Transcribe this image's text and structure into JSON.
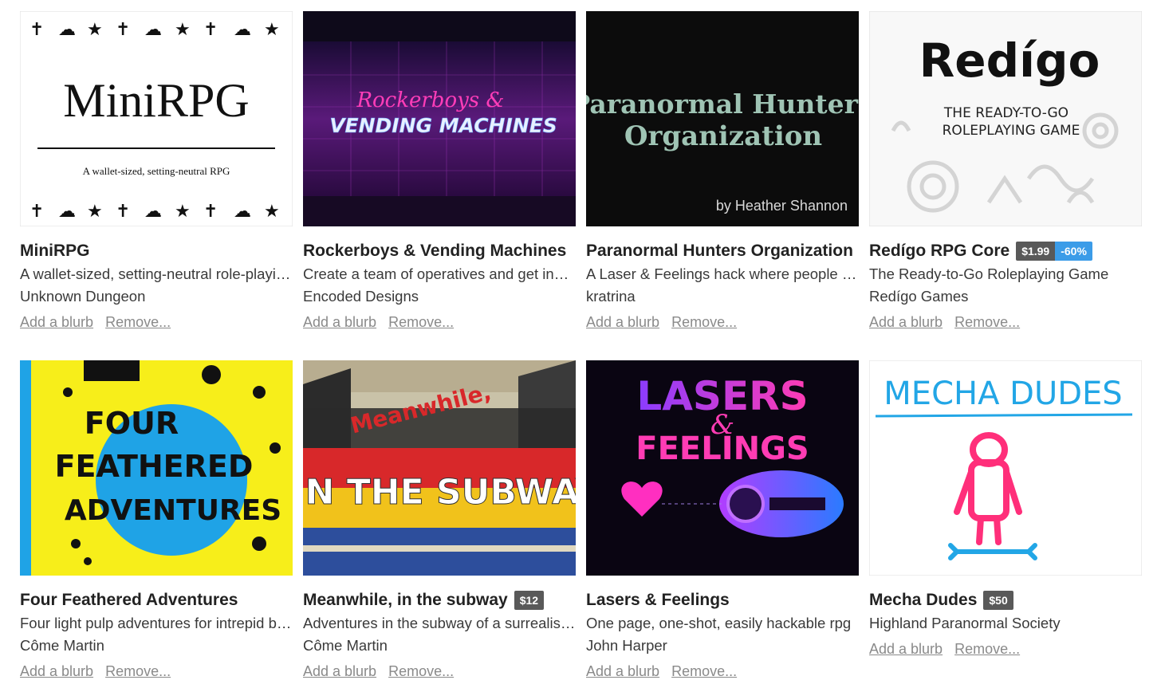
{
  "items": [
    {
      "title": "MiniRPG",
      "description": "A wallet-sized, setting-neutral role-playi…",
      "author": "Unknown Dungeon",
      "price": "",
      "discount": "",
      "cover_text": [
        "MiniRPG",
        "A wallet-sized, setting-neutral RPG"
      ],
      "add_blurb": "Add a blurb",
      "remove": "Remove..."
    },
    {
      "title": "Rockerboys & Vending Machines",
      "description": "Create a team of operatives and get invol…",
      "author": "Encoded Designs",
      "price": "",
      "discount": "",
      "cover_text": [
        "Rockerboys &",
        "VENDING MACHINES"
      ],
      "add_blurb": "Add a blurb",
      "remove": "Remove..."
    },
    {
      "title": "Paranormal Hunters Organization",
      "description": "A Laser & Feelings hack where people ta…",
      "author": "kratrina",
      "price": "",
      "discount": "",
      "cover_text": [
        "Paranormal Hunters",
        "Organization",
        "by Heather Shannon"
      ],
      "add_blurb": "Add a blurb",
      "remove": "Remove..."
    },
    {
      "title": "Redígo RPG Core",
      "description": "The Ready-to-Go Roleplaying Game",
      "author": "Redígo Games",
      "price": "$1.99",
      "discount": "-60%",
      "cover_text": [
        "Redígo",
        "THE READY-TO-GO",
        "ROLEPLAYING GAME"
      ],
      "add_blurb": "Add a blurb",
      "remove": "Remove..."
    },
    {
      "title": "Four Feathered Adventures",
      "description": "Four light pulp adventures for intrepid bi…",
      "author": "Côme Martin",
      "price": "",
      "discount": "",
      "cover_text": [
        "FOUR",
        "FEATHERED",
        "ADVENTURES"
      ],
      "add_blurb": "Add a blurb",
      "remove": "Remove..."
    },
    {
      "title": "Meanwhile, in the subway",
      "description": "Adventures in the subway of a surrealist …",
      "author": "Côme Martin",
      "price": "$12",
      "discount": "",
      "cover_text": [
        "Meanwhile,",
        "IN THE SUBWAY"
      ],
      "add_blurb": "Add a blurb",
      "remove": "Remove..."
    },
    {
      "title": "Lasers & Feelings",
      "description": "One page, one-shot, easily hackable rpg",
      "author": "John Harper",
      "price": "",
      "discount": "",
      "cover_text": [
        "LASERS",
        "&",
        "FEELINGS"
      ],
      "add_blurb": "Add a blurb",
      "remove": "Remove..."
    },
    {
      "title": "Mecha Dudes",
      "description": "Highland Paranormal Society",
      "author": "",
      "price": "$50",
      "discount": "",
      "cover_text": [
        "MECHA DUDES"
      ],
      "add_blurb": "Add a blurb",
      "remove": "Remove..."
    }
  ],
  "colors": {
    "price_badge": "#595959",
    "discount_badge": "#3b9ce8",
    "link_gray": "#8a8a8a"
  }
}
